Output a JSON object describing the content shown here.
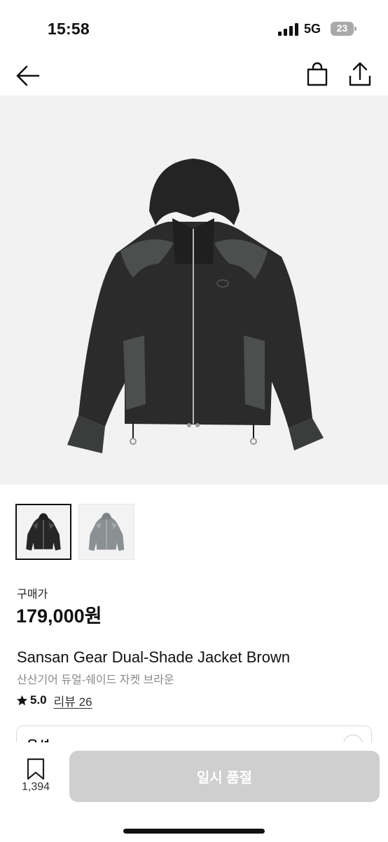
{
  "status_bar": {
    "time": "15:58",
    "network": "5G",
    "battery": "23",
    "icons": [
      "signal-icon",
      "battery-icon"
    ]
  },
  "nav": {
    "icons": [
      "back-arrow-icon",
      "shopping-bag-icon",
      "share-icon"
    ]
  },
  "product": {
    "price_label": "구매가",
    "price": "179,000원",
    "title": "Sansan Gear Dual-Shade Jacket Brown",
    "subtitle": "산산기어 듀얼-쉐이드 자켓 브라운",
    "rating": "5.0",
    "review_link": "리뷰 26",
    "thumbnails": [
      "black-jacket",
      "grey-jacket"
    ]
  },
  "option": {
    "label": "옵션"
  },
  "bottom_bar": {
    "bookmark_count": "1,394",
    "cta_label": "일시 품절"
  },
  "colors": {
    "cta_background": "#cfcfcf",
    "hero_background": "#f2f2f2",
    "jacket_body": "#2a2b2a",
    "jacket_panel": "#4c4f4e",
    "jacket_grey": "#8b9192"
  }
}
